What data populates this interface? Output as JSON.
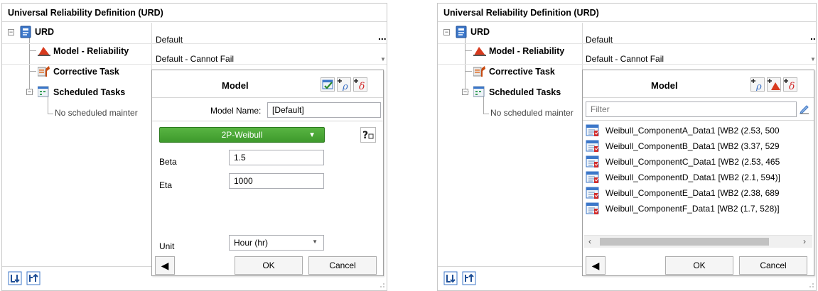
{
  "left": {
    "title": "Universal Reliability Definition (URD)",
    "tree": {
      "root_label": "URD",
      "model_label": "Model - Reliability",
      "corrective_label": "Corrective Task",
      "scheduled_label": "Scheduled Tasks",
      "no_scheduled": "No scheduled mainter"
    },
    "values": {
      "root_value": "Default",
      "model_value": "Default - Cannot Fail",
      "ellipsis": "..."
    },
    "popup": {
      "title": "Model",
      "model_name_label": "Model Name:",
      "model_name_value": "[Default]",
      "distribution": "2P-Weibull",
      "beta_label": "Beta",
      "beta_value": "1.5",
      "eta_label": "Eta",
      "eta_value": "1000",
      "unit_label": "Unit",
      "unit_value": "Hour (hr)",
      "ok": "OK",
      "cancel": "Cancel"
    }
  },
  "right": {
    "title": "Universal Reliability Definition (URD)",
    "tree": {
      "root_label": "URD",
      "model_label": "Model - Reliability",
      "corrective_label": "Corrective Task",
      "scheduled_label": "Scheduled Tasks",
      "no_scheduled": "No scheduled mainter"
    },
    "values": {
      "root_value": "Default",
      "model_value": "Default - Cannot Fail",
      "ellipsis": ".."
    },
    "popup": {
      "title": "Model",
      "filter_placeholder": "Filter",
      "items": [
        "Weibull_ComponentA_Data1 [WB2 (2.53, 500",
        "Weibull_ComponentB_Data1 [WB2 (3.37, 529",
        "Weibull_ComponentC_Data1 [WB2 (2.53, 465",
        "Weibull_ComponentD_Data1 [WB2 (2.1, 594)]",
        "Weibull_ComponentE_Data1 [WB2 (2.38, 689",
        "Weibull_ComponentF_Data1 [WB2 (1.7, 528)]"
      ],
      "ok": "OK",
      "cancel": "Cancel"
    }
  },
  "colors": {
    "green_select": "#4aa537",
    "reliability_icon": "#d83a1e",
    "task_icon": "#e06010",
    "plus_icon_accent": "#d12c2c",
    "rho_blue": "#3a6fc4"
  }
}
